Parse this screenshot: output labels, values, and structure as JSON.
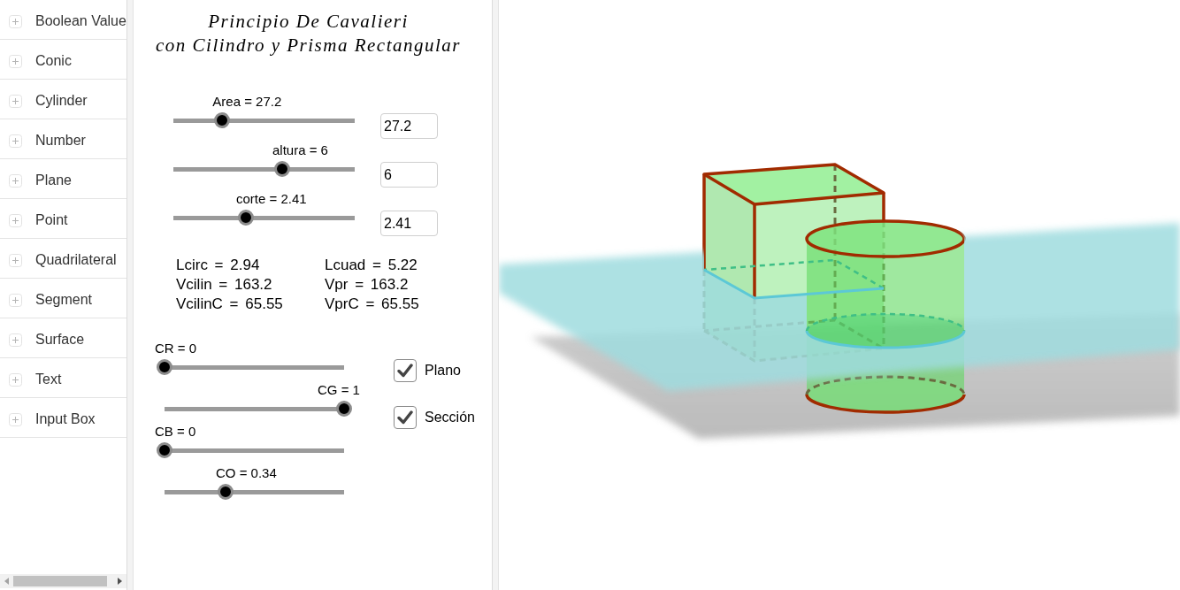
{
  "sidebar": {
    "items": [
      {
        "label": "Boolean Value",
        "expanded": false
      },
      {
        "label": "Conic",
        "expanded": false
      },
      {
        "label": "Cylinder",
        "expanded": false
      },
      {
        "label": "Number",
        "expanded": false
      },
      {
        "label": "Plane",
        "expanded": false
      },
      {
        "label": "Point",
        "expanded": false
      },
      {
        "label": "Quadrilateral",
        "expanded": false
      },
      {
        "label": "Segment",
        "expanded": false
      },
      {
        "label": "Surface",
        "expanded": false
      },
      {
        "label": "Text",
        "expanded": false
      },
      {
        "label": "Input Box",
        "expanded": false
      }
    ]
  },
  "graphics": {
    "title": [
      "Principio De Cavalieri",
      "con Cilindro y Prisma Rectangular"
    ],
    "sliders": [
      {
        "label": "Area = 27.2",
        "level": 0.27,
        "input_value": "27.2"
      },
      {
        "label": "altura = 6",
        "level": 0.6,
        "input_value": "6"
      },
      {
        "label": "corte = 2.41",
        "level": 0.4,
        "input_value": "2.41"
      }
    ],
    "measures": [
      {
        "left": "Lcirc = 2.94",
        "right": "Lcuad = 5.22"
      },
      {
        "left": "Vcilin = 163.2",
        "right": "Vpr = 163.2"
      },
      {
        "left": "VcilinC = 65.55",
        "right": "VprC = 65.55"
      }
    ],
    "color_sliders": [
      {
        "label": "CR = 0",
        "level": 0
      },
      {
        "label": "CG = 1",
        "level": 1
      },
      {
        "label": "CB = 0",
        "level": 0
      },
      {
        "label": "CO = 0.34",
        "level": 0.34
      }
    ],
    "checkboxes": [
      {
        "label": "Plano",
        "checked": true
      },
      {
        "label": "Sección",
        "checked": true
      }
    ]
  }
}
